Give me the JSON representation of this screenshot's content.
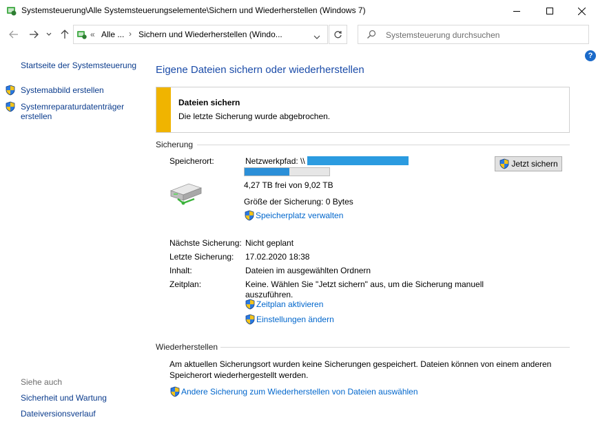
{
  "window": {
    "title": "Systemsteuerung\\Alle Systemsteuerungselemente\\Sichern und Wiederherstellen (Windows 7)",
    "controls": {
      "minimize": "—",
      "maximize": "☐",
      "close": "✕"
    }
  },
  "address": {
    "chevrons": "«",
    "crumb1": "Alle ...",
    "sep": "›",
    "crumb2": "Sichern und Wiederherstellen (Windo...",
    "dropdown": "⌄",
    "refresh": "↻"
  },
  "search": {
    "placeholder": "Systemsteuerung durchsuchen"
  },
  "help": {
    "label": "?"
  },
  "sidebar": {
    "home": "Startseite der Systemsteuerung",
    "items": [
      {
        "label": "Systemabbild erstellen"
      },
      {
        "label_line1": "Systemreparaturdatenträger",
        "label_line2": "erstellen"
      }
    ],
    "see_also_title": "Siehe auch",
    "see_also": [
      "Sicherheit und Wartung",
      "Dateiversionsverlauf"
    ]
  },
  "main": {
    "title": "Eigene Dateien sichern oder wiederherstellen",
    "alert": {
      "title": "Dateien sichern",
      "message": "Die letzte Sicherung wurde abgebrochen."
    },
    "backup": {
      "section": "Sicherung",
      "location_label": "Speicherort:",
      "location_value": "Netzwerkpfad: \\\\",
      "usage_fraction": 0.53,
      "free_text": "4,27 TB frei von 9,02 TB",
      "size_text": "Größe der Sicherung: 0 Bytes",
      "manage_link": "Speicherplatz verwalten",
      "backup_button": "Jetzt sichern",
      "rows": [
        {
          "label": "Nächste Sicherung:",
          "value": "Nicht geplant"
        },
        {
          "label": "Letzte Sicherung:",
          "value": "17.02.2020 18:38"
        },
        {
          "label": "Inhalt:",
          "value": "Dateien im ausgewählten Ordnern"
        },
        {
          "label": "Zeitplan:",
          "value": "Keine. Wählen Sie \"Jetzt sichern\" aus, um die Sicherung manuell",
          "value_line2": "auszuführen."
        }
      ],
      "schedule_link": "Zeitplan aktivieren",
      "settings_link": "Einstellungen ändern"
    },
    "restore": {
      "section": "Wiederherstellen",
      "message_line1": "Am aktuellen Sicherungsort wurden keine Sicherungen gespeichert. Dateien können von einem anderen",
      "message_line2": "Speicherort wiederhergestellt werden.",
      "link": "Andere Sicherung zum Wiederherstellen von Dateien auswählen"
    }
  },
  "colors": {
    "link": "#0066cc",
    "title": "#1a4ba8",
    "alert_bar": "#f0b400",
    "progress": "#2b8fd8"
  }
}
